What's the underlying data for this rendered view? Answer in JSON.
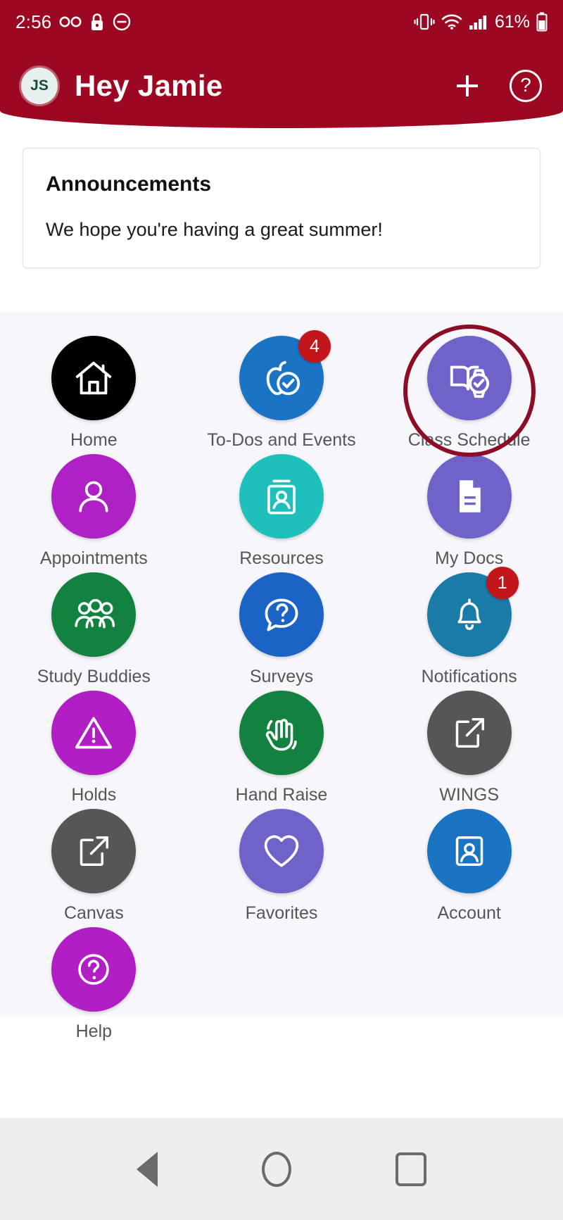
{
  "status_bar": {
    "time": "2:56",
    "battery_percent": "61%",
    "left_icons": [
      "voicemail-icon",
      "lock-icon",
      "do-not-disturb-icon"
    ],
    "right_icons": [
      "vibrate-icon",
      "wifi-icon",
      "cellular-signal-icon",
      "battery-icon"
    ]
  },
  "header": {
    "avatar_initials": "JS",
    "greeting": "Hey Jamie",
    "add_label": "+",
    "help_label": "?",
    "background_color": "#9c0822"
  },
  "announcements": {
    "title": "Announcements",
    "message": "We hope you're having a great summer!"
  },
  "annotation": {
    "shape": "circle",
    "color": "#8d0c26",
    "target": "Class Schedule"
  },
  "tiles": [
    {
      "label": "Home",
      "icon": "house-icon",
      "color": "#000000",
      "badge": null
    },
    {
      "label": "To-Dos and Events",
      "icon": "apple-check-icon",
      "color": "#1b73c4",
      "badge": "4"
    },
    {
      "label": "Class Schedule",
      "icon": "book-watch-icon",
      "color": "#6f63c9",
      "badge": null
    },
    {
      "label": "Appointments",
      "icon": "person-icon",
      "color": "#ae21c4",
      "badge": null
    },
    {
      "label": "Resources",
      "icon": "id-card-icon",
      "color": "#1fbfbb",
      "badge": null
    },
    {
      "label": "My Docs",
      "icon": "document-icon",
      "color": "#6f63c9",
      "badge": null
    },
    {
      "label": "Study Buddies",
      "icon": "people-group-icon",
      "color": "#13813f",
      "badge": null
    },
    {
      "label": "Surveys",
      "icon": "question-bubble-icon",
      "color": "#1b63c4",
      "badge": null
    },
    {
      "label": "Notifications",
      "icon": "bell-icon",
      "color": "#1a7ba8",
      "badge": "1"
    },
    {
      "label": "Holds",
      "icon": "warning-triangle-icon",
      "color": "#b01ec4",
      "badge": null
    },
    {
      "label": "Hand Raise",
      "icon": "hand-raise-icon",
      "color": "#13813f",
      "badge": null
    },
    {
      "label": "WINGS",
      "icon": "external-link-icon",
      "color": "#565656",
      "badge": null
    },
    {
      "label": "Canvas",
      "icon": "external-link-icon",
      "color": "#565656",
      "badge": null
    },
    {
      "label": "Favorites",
      "icon": "heart-icon",
      "color": "#6f63c9",
      "badge": null
    },
    {
      "label": "Account",
      "icon": "account-card-icon",
      "color": "#1b73c4",
      "badge": null
    },
    {
      "label": "Help",
      "icon": "question-circle-icon",
      "color": "#b01ec4",
      "badge": null
    }
  ],
  "nav_bar": {
    "back_label": "Back",
    "home_label": "Home",
    "recents_label": "Recents"
  }
}
